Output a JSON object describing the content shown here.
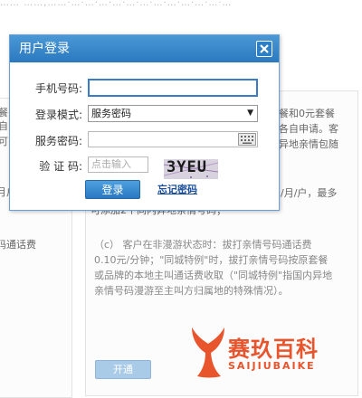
{
  "background": {
    "top_strip": "……  ……,……·…·…·…·…·…·…·…·…·…·…·…·…",
    "right_panel": {
      "line1": "餐和0元套餐",
      "line2": "各自申请。客",
      "line3": "异地亲情包随",
      "line4": "/月/户，最多",
      "line5": "可添加2个同内异地亲情号码；",
      "para_c_1": "（c） 客户在非漫游状态时：拔打亲情号码通话费",
      "para_c_2": "0.10元/分钟；\"同城特例\"时，拔打亲情号码按原套餐",
      "para_c_3": "或品牌的本地主叫通话费收取（\"同城特例\"指国内异地",
      "para_c_4": "亲情号码漫游至主叫方归属地的特殊情况）。"
    },
    "left_panel": {
      "line1": "餐",
      "line2": "自",
      "line3": "可",
      "line4": "月户",
      "line5": "码通话费"
    },
    "open_button_label": "开通",
    "watermark_brand": "赛玖百科",
    "watermark_sub": "SAIJIUBAIKE"
  },
  "dialog": {
    "title": "用户登录",
    "phone_label": "手机号码:",
    "phone_value": "",
    "mode_label": "登录模式:",
    "mode_selected": "服务密码",
    "password_label": "服务密码:",
    "password_value": "",
    "captcha_label": "验 证 码:",
    "captcha_placeholder": "点击输入",
    "captcha_text": "3YEU",
    "login_label": "登录",
    "forgot_label": "忘记密码"
  },
  "colors": {
    "title_bar": "#3a88cb",
    "login_button": "#2a78c2",
    "watermark": "#e8542b"
  }
}
